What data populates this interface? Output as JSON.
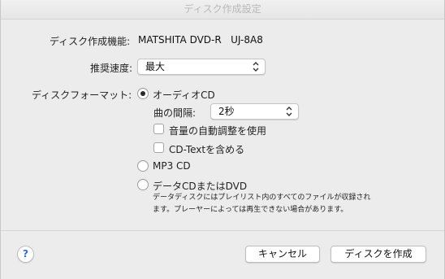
{
  "window": {
    "title": "ディスク作成設定"
  },
  "device": {
    "label": "ディスク作成機能:",
    "value": "MATSHITA DVD-R   UJ-8A8"
  },
  "speed": {
    "label": "推奨速度:",
    "selected": "最大"
  },
  "format": {
    "label": "ディスクフォーマット:",
    "options": [
      {
        "label": "オーディオCD",
        "selected": true
      },
      {
        "label": "MP3 CD",
        "selected": false
      },
      {
        "label": "データCDまたはDVD",
        "selected": false
      }
    ],
    "audio": {
      "gap_label": "曲の間隔:",
      "gap_selected": "2秒",
      "volume_label": "音量の自動調整を使用",
      "volume_checked": false,
      "cdtext_label": "CD-Textを含める",
      "cdtext_checked": false
    },
    "data_description": "データディスクにはプレイリスト内のすべてのファイルが収録されます。プレーヤーによっては再生できない場合があります。"
  },
  "buttons": {
    "help": "?",
    "cancel": "キャンセル",
    "burn": "ディスクを作成"
  },
  "icons": {
    "help": "help-icon",
    "popup": "chevron-updown-icon"
  }
}
